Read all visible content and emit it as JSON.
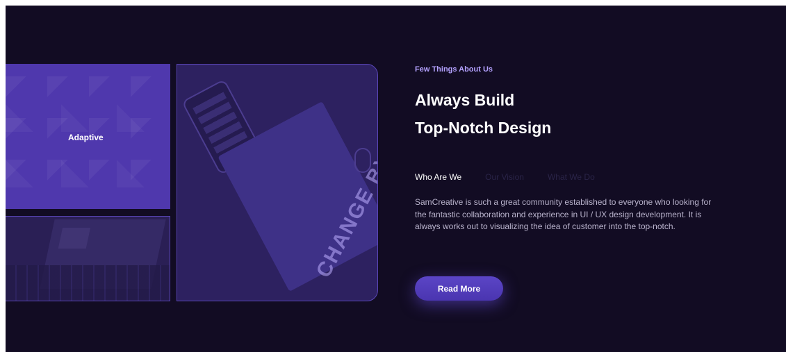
{
  "gallery": {
    "adaptive_label": "Adaptive",
    "board_text": "CHANGE BY DESIGN"
  },
  "about": {
    "eyebrow": "Few Things About Us",
    "title_line1": "Always Build",
    "title_line2": "Top-Notch Design",
    "tabs": [
      {
        "label": "Who Are We",
        "active": true
      },
      {
        "label": "Our Vision",
        "active": false
      },
      {
        "label": "What We Do",
        "active": false
      }
    ],
    "description": "SamCreative is such a great community established to everyone who looking for the fantastic collaboration and experience in UI / UX design development. It is always works out to visualizing the idea of customer into the top-notch.",
    "cta_label": "Read More"
  },
  "colors": {
    "background": "#120c23",
    "accent": "#4f38ad",
    "eyebrow": "#b4a2ff",
    "text_muted": "#b9b3cc"
  }
}
